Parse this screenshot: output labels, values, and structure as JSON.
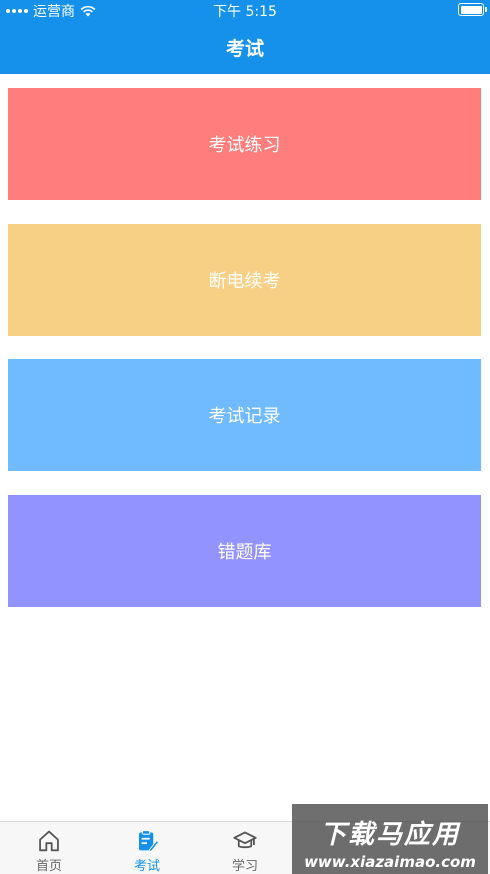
{
  "status_bar": {
    "carrier": "运营商",
    "time": "下午 5:15"
  },
  "header": {
    "title": "考试"
  },
  "menu": [
    {
      "label": "考试练习",
      "color": "#ff7d7a"
    },
    {
      "label": "断电续考",
      "color": "#f8d085"
    },
    {
      "label": "考试记录",
      "color": "#70baff"
    },
    {
      "label": "错题库",
      "color": "#9393ff"
    }
  ],
  "tabs": [
    {
      "label": "首页",
      "icon": "home-icon"
    },
    {
      "label": "考试",
      "icon": "exam-icon",
      "active": true
    },
    {
      "label": "学习",
      "icon": "study-cap-icon"
    },
    {
      "label": "",
      "icon": "obscured-icon"
    },
    {
      "label": "",
      "icon": "obscured-icon"
    }
  ],
  "watermark": {
    "title": "下载马应用",
    "url": "www.xiazaimao.com"
  },
  "colors": {
    "primary": "#1591ec",
    "tab_inactive": "#666666"
  }
}
